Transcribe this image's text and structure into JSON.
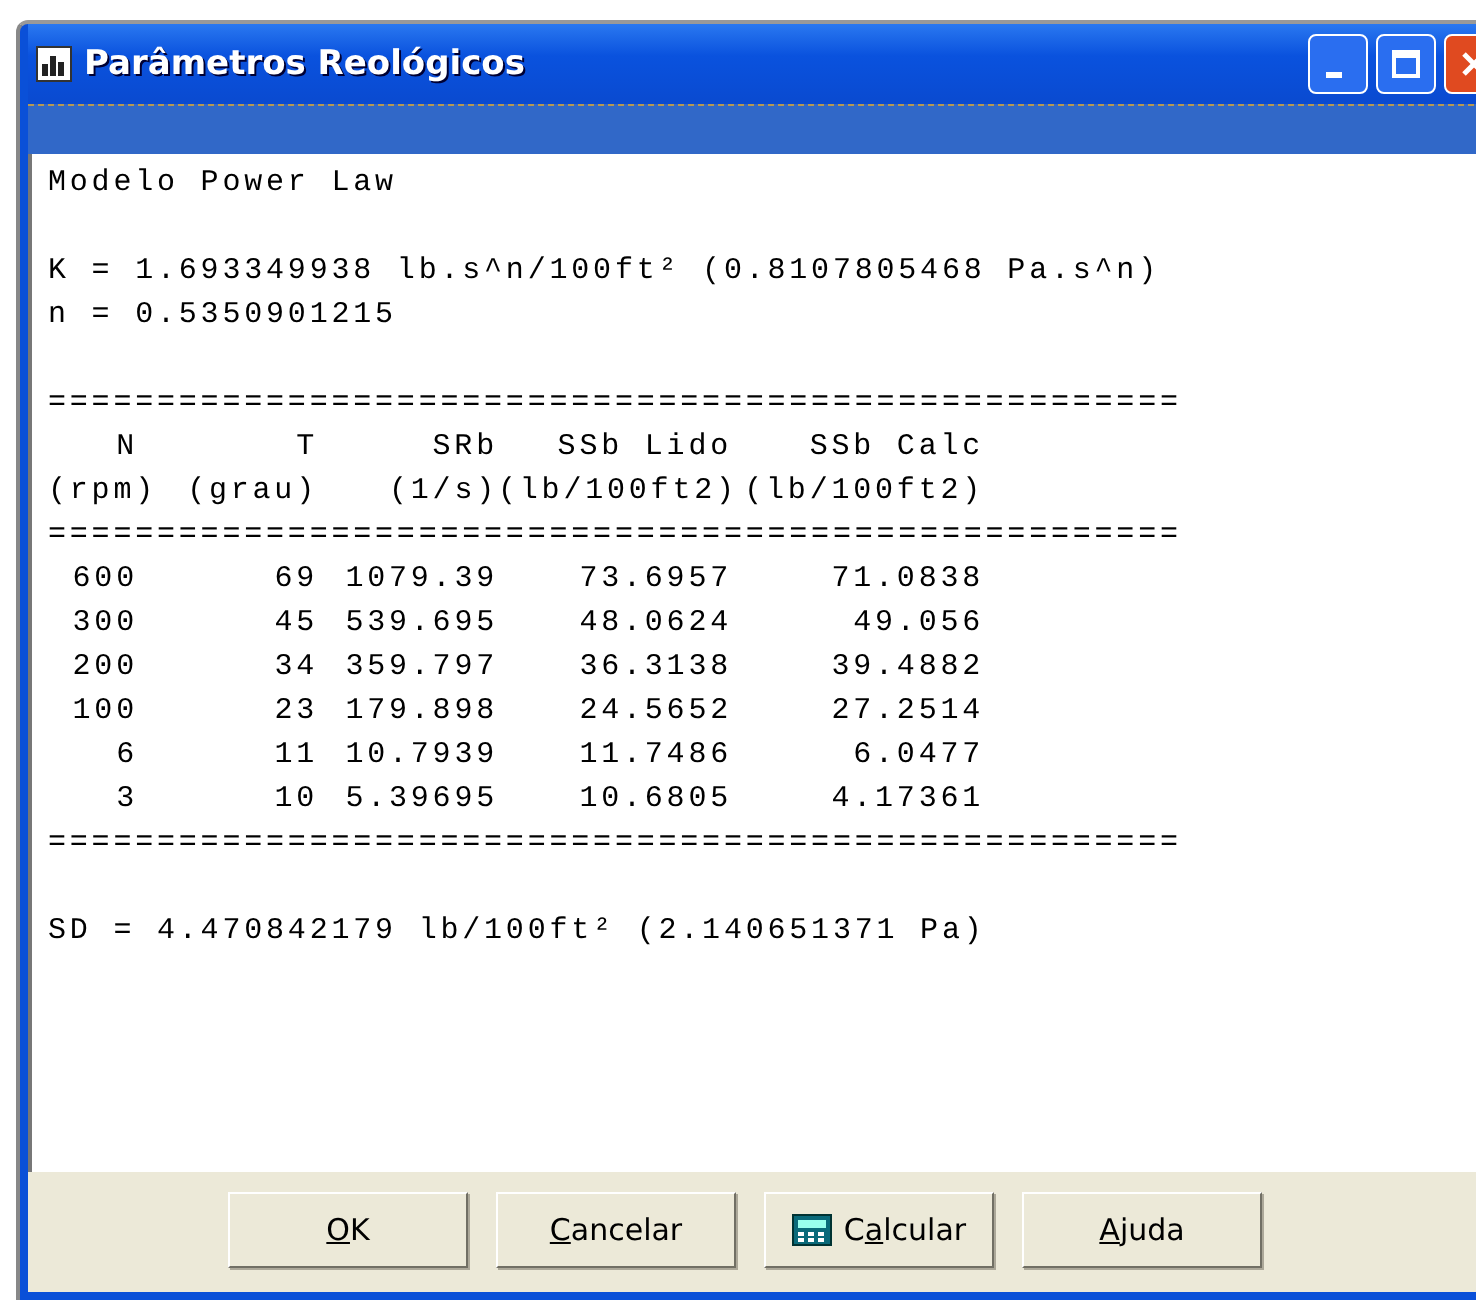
{
  "window": {
    "title": "Parâmetros Reológicos"
  },
  "report": {
    "model_line": "Modelo Power Law",
    "lines_top": [
      "K = 1.693349938 lb.s^n/100ft² (0.8107805468 Pa.s^n)",
      "n = 0.5350901215"
    ],
    "rule": "====================================================",
    "header_rows": [
      [
        "N",
        "T",
        "SRb",
        "SSb Lido",
        "SSb Calc"
      ],
      [
        "(rpm)",
        "(grau)",
        "(1/s)",
        "(lb/100ft2)",
        "(lb/100ft2)"
      ]
    ],
    "rows": [
      [
        "600",
        "69",
        "1079.39",
        "73.6957",
        "71.0838"
      ],
      [
        "300",
        "45",
        "539.695",
        "48.0624",
        "49.056"
      ],
      [
        "200",
        "34",
        "359.797",
        "36.3138",
        "39.4882"
      ],
      [
        "100",
        "23",
        "179.898",
        "24.5652",
        "27.2514"
      ],
      [
        "6",
        "11",
        "10.7939",
        "11.7486",
        "6.0477"
      ],
      [
        "3",
        "10",
        "5.39695",
        "10.6805",
        "4.17361"
      ]
    ],
    "lines_bottom": [
      "SD = 4.470842179 lb/100ft² (2.140651371 Pa)"
    ]
  },
  "buttons": [
    {
      "kind": "plain",
      "key": "O",
      "after": "K"
    },
    {
      "kind": "plain",
      "key": "C",
      "after": "ancelar"
    },
    {
      "kind": "calc",
      "before": "C",
      "key": "a",
      "after": "lcular"
    },
    {
      "kind": "plain",
      "key": "A",
      "after": "juda"
    }
  ]
}
